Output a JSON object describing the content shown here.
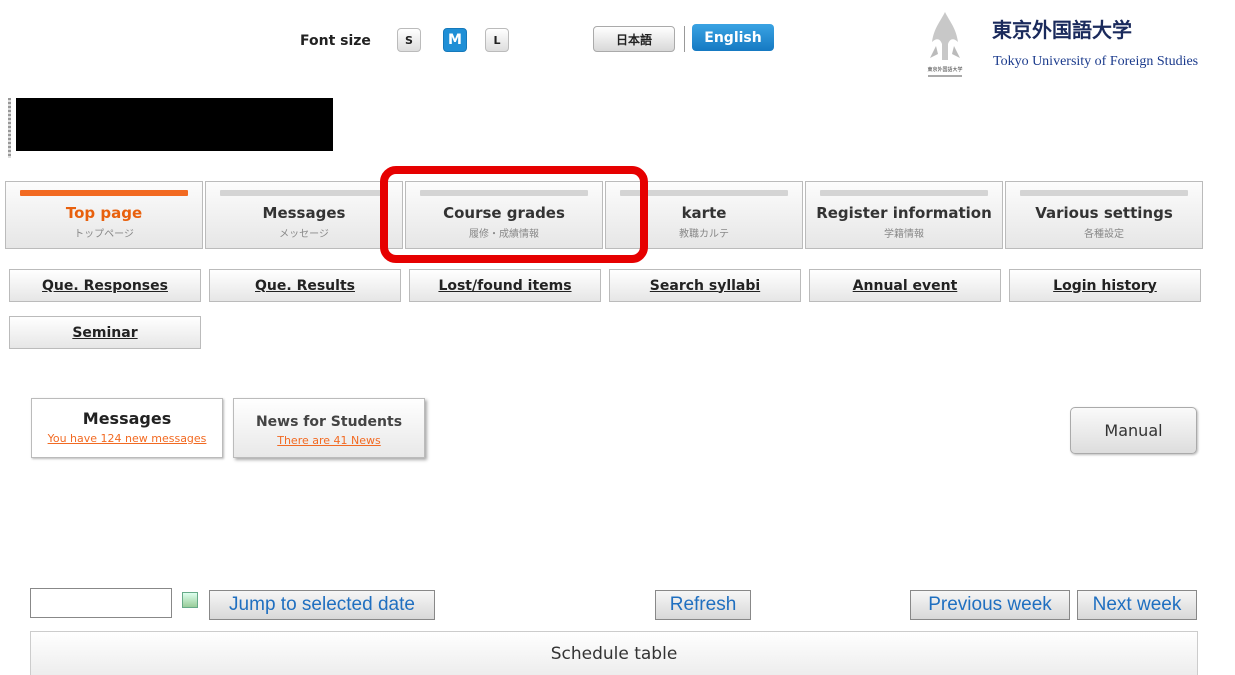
{
  "header": {
    "font_size_label": "Font size",
    "font_sizes": [
      "S",
      "M",
      "L"
    ],
    "font_size_selected": "M",
    "lang_japanese": "日本語",
    "lang_english": "English",
    "university_name_ja": "東京外国語大学",
    "university_name_en": "Tokyo University of Foreign Studies",
    "emblem_caption": "東京外国語大学"
  },
  "main_tabs": [
    {
      "label": "Top page",
      "sub": "トップページ",
      "active": true
    },
    {
      "label": "Messages",
      "sub": "メッセージ"
    },
    {
      "label": "Course grades",
      "sub": "履修・成績情報"
    },
    {
      "label": "karte",
      "sub": "教職カルテ"
    },
    {
      "label": "Register information",
      "sub": "学籍情報"
    },
    {
      "label": "Various settings",
      "sub": "各種設定"
    }
  ],
  "sub_nav": [
    "Que. Responses",
    "Que. Results",
    "Lost/found items",
    "Search syllabi",
    "Annual event",
    "Login history",
    "Seminar"
  ],
  "info_tabs": {
    "messages": {
      "title": "Messages",
      "link": "You have  124 new messages"
    },
    "news": {
      "title": "News for Students",
      "link": "There are 41 News"
    }
  },
  "manual_label": "Manual",
  "schedule": {
    "date_value": "",
    "jump_label": "Jump to selected date",
    "refresh_label": "Refresh",
    "prev_label": "Previous week",
    "next_label": "Next week",
    "table_title": "Schedule table"
  },
  "colors": {
    "accent": "#f26a22",
    "blue": "#1f8fd6",
    "highlight": "#e60000"
  }
}
